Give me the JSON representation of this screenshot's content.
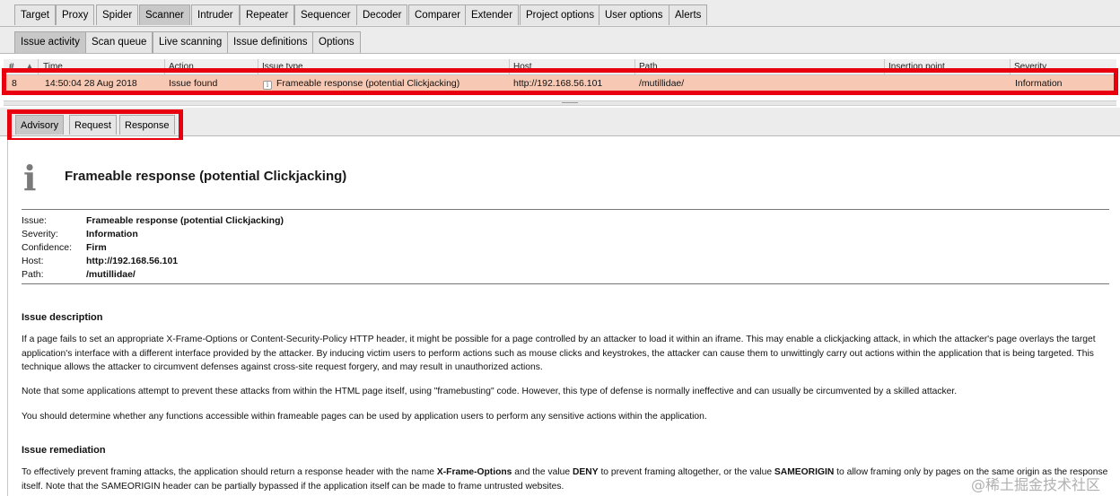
{
  "top_tabs": [
    "Target",
    "Proxy",
    "Spider",
    "Scanner",
    "Intruder",
    "Repeater",
    "Sequencer",
    "Decoder",
    "Comparer",
    "Extender",
    "Project options",
    "User options",
    "Alerts"
  ],
  "sub_tabs": [
    "Issue activity",
    "Scan queue",
    "Live scanning",
    "Issue definitions",
    "Options"
  ],
  "table": {
    "headers": [
      "#",
      "Time",
      "Action",
      "Issue type",
      "Host",
      "Path",
      "Insertion point",
      "Severity"
    ],
    "row": {
      "num": "8",
      "time": "14:50:04 28 Aug 2018",
      "action": "Issue found",
      "issue_icon": "i",
      "issue_type": "Frameable response (potential Clickjacking)",
      "host": "http://192.168.56.101",
      "path": "/mutillidae/",
      "insertion_point": "",
      "severity": "Information"
    }
  },
  "message_tabs": [
    "Advisory",
    "Request",
    "Response"
  ],
  "advisory": {
    "icon": "i",
    "title": "Frameable response (potential Clickjacking)",
    "details": [
      {
        "key": "Issue:",
        "value": "Frameable response (potential Clickjacking)"
      },
      {
        "key": "Severity:",
        "value": "Information"
      },
      {
        "key": "Confidence:",
        "value": "Firm"
      },
      {
        "key": "Host:",
        "value": "http://192.168.56.101"
      },
      {
        "key": "Path:",
        "value": "/mutillidae/"
      }
    ],
    "description_heading": "Issue description",
    "description_paragraphs": [
      "If a page fails to set an appropriate X-Frame-Options or Content-Security-Policy HTTP header, it might be possible for a page controlled by an attacker to load it within an iframe. This may enable a clickjacking attack, in which the attacker's page overlays the target application's interface with a different interface provided by the attacker. By inducing victim users to perform actions such as mouse clicks and keystrokes, the attacker can cause them to unwittingly carry out actions within the application that is being targeted. This technique allows the attacker to circumvent defenses against cross-site request forgery, and may result in unauthorized actions.",
      "Note that some applications attempt to prevent these attacks from within the HTML page itself, using \"framebusting\" code. However, this type of defense is normally ineffective and can usually be circumvented by a skilled attacker.",
      "You should determine whether any functions accessible within frameable pages can be used by application users to perform any sensitive actions within the application."
    ],
    "remediation_heading": "Issue remediation",
    "remediation": {
      "part1": "To effectively prevent framing attacks, the application should return a response header with the name ",
      "header_name": "X-Frame-Options",
      "part2": " and the value ",
      "deny": "DENY",
      "part3": " to prevent framing altogether, or the value ",
      "sameorigin": "SAMEORIGIN",
      "part4": " to allow framing only by pages on the same origin as the response itself. Note that the SAMEORIGIN header can be partially bypassed if the application itself can be made to frame untrusted websites."
    }
  },
  "watermark": "@稀土掘金技术社区",
  "colors": {
    "selected_row": "#f7c9b4",
    "highlight_box": "#e8000f",
    "tab_active": "#c8c8c8"
  }
}
